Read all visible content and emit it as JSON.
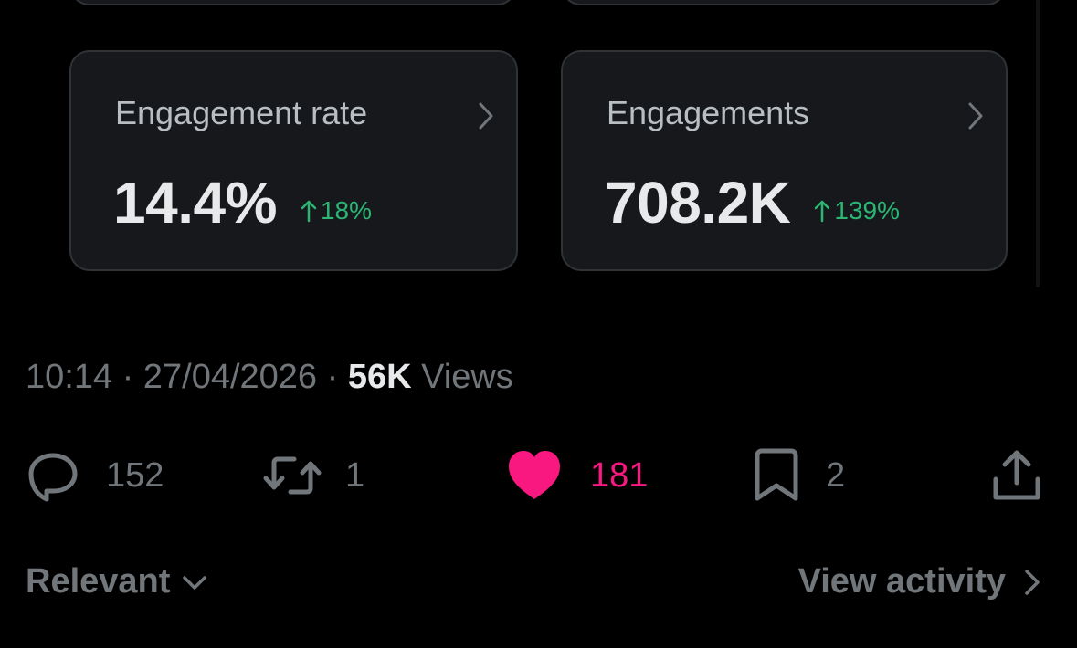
{
  "analytics_cards": [
    {
      "label": "Engagement rate",
      "value": "14.4%",
      "delta": "18%",
      "delta_direction": "up"
    },
    {
      "label": "Engagements",
      "value": "708.2K",
      "delta": "139%",
      "delta_direction": "up"
    }
  ],
  "post_meta": {
    "time": "10:14",
    "separator": "·",
    "date": "27/04/2026",
    "views_count": "56K",
    "views_label": "Views"
  },
  "actions": {
    "replies": "152",
    "reposts": "1",
    "likes": "181",
    "bookmarks": "2"
  },
  "footer": {
    "sort_label": "Relevant",
    "view_activity_label": "View activity"
  },
  "colors": {
    "background": "#000000",
    "card_background": "#16181c",
    "card_border": "#2f3336",
    "muted_text": "#71767b",
    "primary_text": "#e7e9ea",
    "positive_delta": "#2bb673",
    "like_pink": "#f91880"
  },
  "icons": [
    "chevron-right-icon",
    "arrow-up-icon",
    "reply-icon",
    "repost-icon",
    "heart-icon",
    "bookmark-icon",
    "share-icon",
    "chevron-down-icon"
  ]
}
